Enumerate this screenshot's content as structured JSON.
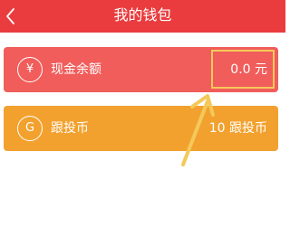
{
  "header": {
    "title": "我的钱包"
  },
  "cards": [
    {
      "icon_glyph": "¥",
      "label": "现金余额",
      "value": "0.0 元"
    },
    {
      "icon_glyph": "G",
      "label": "跟投币",
      "value": "10 跟投币"
    }
  ],
  "colors": {
    "header": "#ea3c3e",
    "cash_card": "#f05d5b",
    "coin_card": "#f2a12e",
    "annotation": "#f4c95a"
  }
}
